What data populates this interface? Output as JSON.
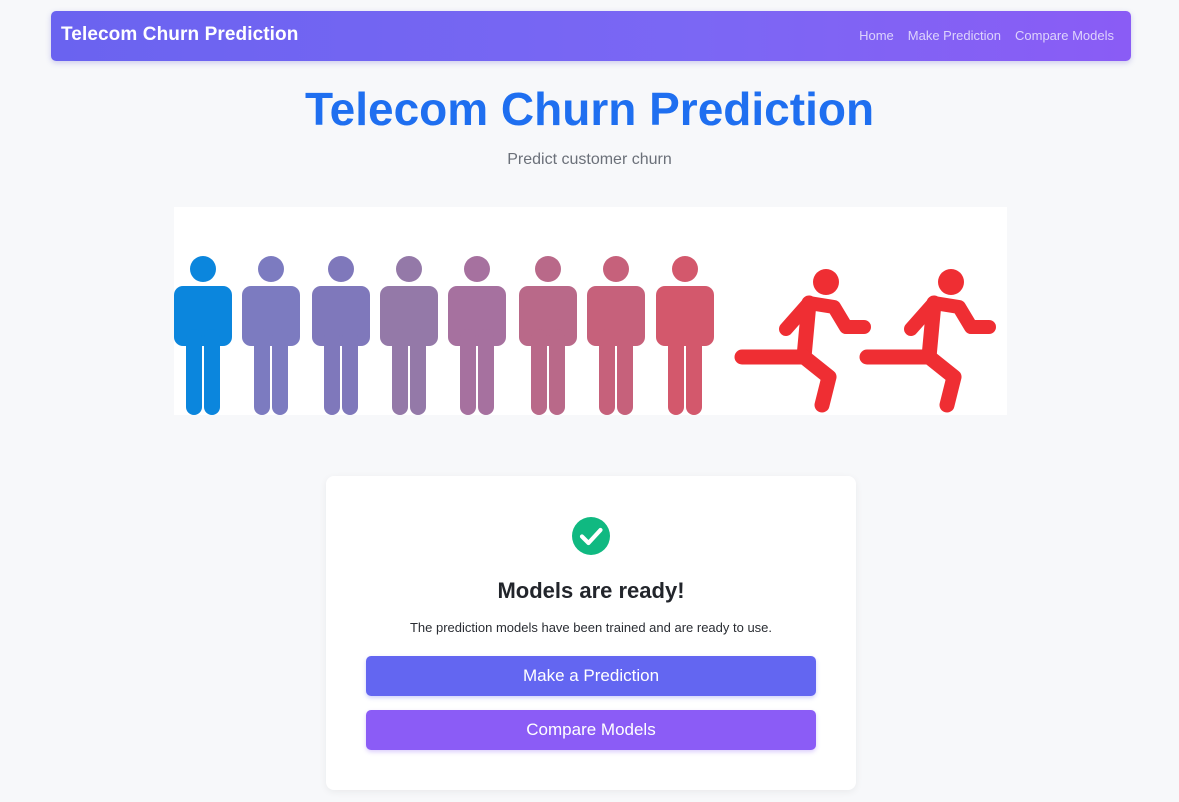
{
  "navbar": {
    "brand": "Telecom Churn Prediction",
    "links": [
      "Home",
      "Make Prediction",
      "Compare Models"
    ]
  },
  "hero": {
    "title": "Telecom Churn Prediction",
    "subtitle": "Predict customer churn"
  },
  "banner": {
    "icons": [
      "person-icon",
      "running-person-icon"
    ],
    "standing_colors": [
      "#0b86dd",
      "#7c7bc0",
      "#7f78bb",
      "#9479a8",
      "#a6719f",
      "#b96989",
      "#c6617b",
      "#d3586c"
    ],
    "runner_color": "#ef2e33"
  },
  "status_card": {
    "icon": "check-circle-icon",
    "icon_color": "#10b981",
    "title": "Models are ready!",
    "message": "The prediction models have been trained and are ready to use.",
    "primary_button": "Make a Prediction",
    "secondary_button": "Compare Models"
  }
}
